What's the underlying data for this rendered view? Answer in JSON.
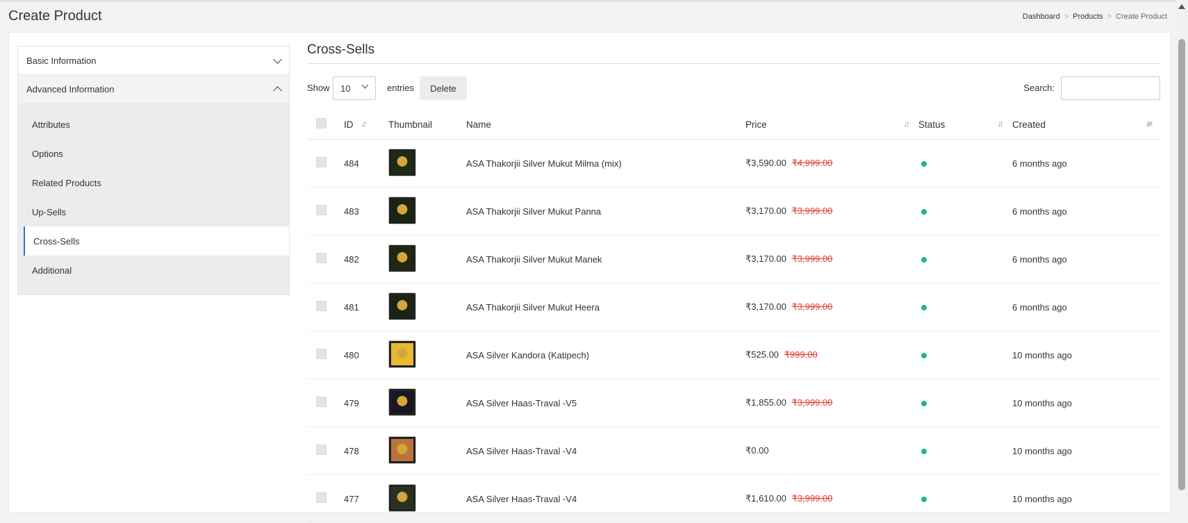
{
  "page": {
    "title": "Create Product"
  },
  "breadcrumb": {
    "items": [
      "Dashboard",
      "Products",
      "Create Product"
    ],
    "sep": ">"
  },
  "sidebar": {
    "sections": [
      {
        "label": "Basic Information",
        "state": "collapsed"
      },
      {
        "label": "Advanced Information",
        "state": "expanded"
      }
    ],
    "items": [
      "Attributes",
      "Options",
      "Related Products",
      "Up-Sells",
      "Cross-Sells",
      "Additional"
    ],
    "active_item": "Cross-Sells"
  },
  "main": {
    "title": "Cross-Sells",
    "toolbar": {
      "show_label": "Show",
      "entries_value": "10",
      "entries_label": "entries",
      "delete_label": "Delete",
      "search_label": "Search:",
      "search_value": ""
    },
    "columns": [
      "ID",
      "Thumbnail",
      "Name",
      "Price",
      "Status",
      "Created"
    ],
    "rows": [
      {
        "id": "484",
        "name": "ASA Thakorjii Silver Mukut Milma (mix)",
        "price": "₹3,590.00",
        "old_price": "₹4,999.00",
        "created": "6 months ago",
        "thumb_color": "#1d2a14"
      },
      {
        "id": "483",
        "name": "ASA Thakorjii Silver Mukut Panna",
        "price": "₹3,170.00",
        "old_price": "₹3,999.00",
        "created": "6 months ago",
        "thumb_color": "#1a2410"
      },
      {
        "id": "482",
        "name": "ASA Thakorjii Silver Mukut Manek",
        "price": "₹3,170.00",
        "old_price": "₹3,999.00",
        "created": "6 months ago",
        "thumb_color": "#21270f"
      },
      {
        "id": "481",
        "name": "ASA Thakorjii Silver Mukut Heera",
        "price": "₹3,170.00",
        "old_price": "₹3,999.00",
        "created": "6 months ago",
        "thumb_color": "#1b2312"
      },
      {
        "id": "480",
        "name": "ASA Silver Kandora (Katipech)",
        "price": "₹525.00",
        "old_price": "₹999.00",
        "created": "10 months ago",
        "thumb_color": "#e8b92e"
      },
      {
        "id": "479",
        "name": "ASA Silver Haas-Traval -V5",
        "price": "₹1,855.00",
        "old_price": "₹3,999.00",
        "created": "10 months ago",
        "thumb_color": "#1a1722"
      },
      {
        "id": "478",
        "name": "ASA Silver Haas-Traval -V4",
        "price": "₹0.00",
        "old_price": "",
        "created": "10 months ago",
        "thumb_color": "#b9743e"
      },
      {
        "id": "477",
        "name": "ASA Silver Haas-Traval -V4",
        "price": "₹1,610.00",
        "old_price": "₹3,999.00",
        "created": "10 months ago",
        "thumb_color": "#2a3020"
      }
    ]
  },
  "colors": {
    "accent": "#2a73cc",
    "status_active": "#20b587",
    "old_price": "#e53935"
  }
}
